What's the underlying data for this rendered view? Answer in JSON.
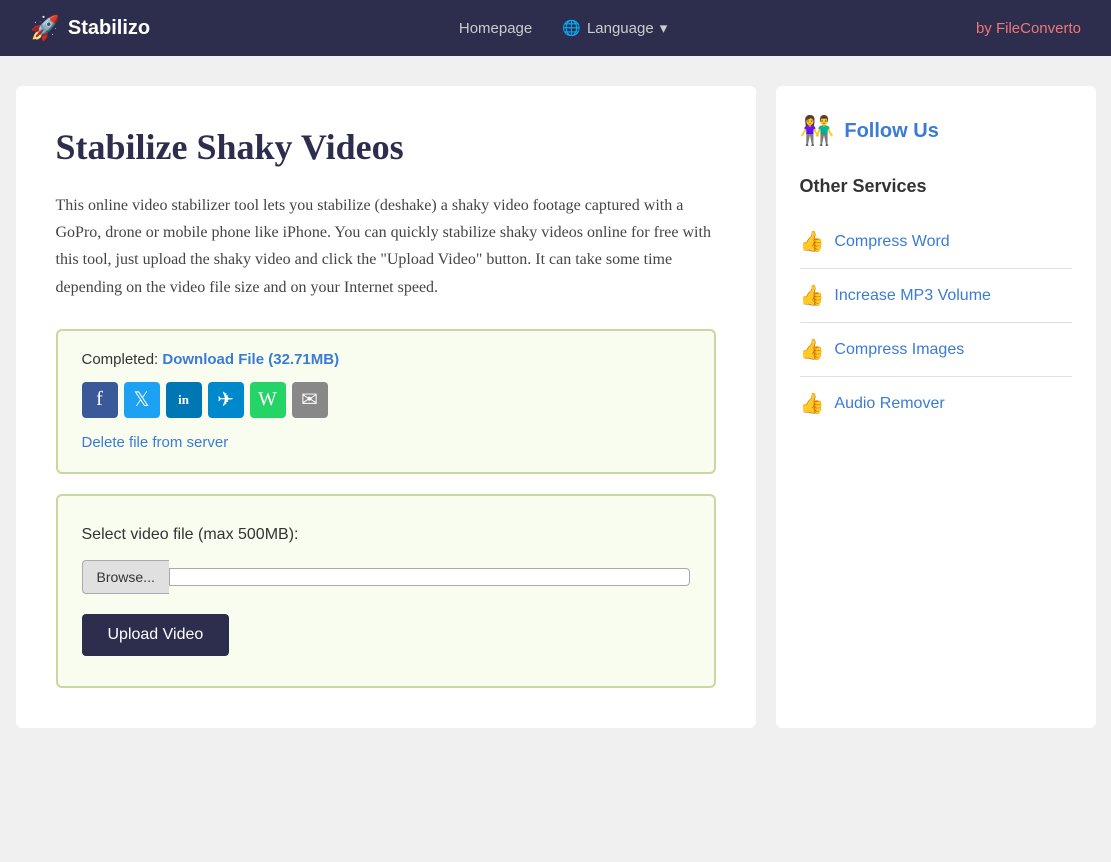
{
  "nav": {
    "logo_text": "Stabilizo",
    "logo_icon": "🚀",
    "homepage_label": "Homepage",
    "language_label": "Language",
    "language_icon": "🌐",
    "byline": "by FileConvert",
    "byline_highlight": "o"
  },
  "main": {
    "title": "Stabilize Shaky Videos",
    "description": "This online video stabilizer tool lets you stabilize (deshake) a shaky video footage captured with a GoPro, drone or mobile phone like iPhone. You can quickly stabilize shaky videos online for free with this tool, just upload the shaky video and click the \"Upload Video\" button. It can take some time depending on the video file size and on your Internet speed.",
    "completed_label": "Completed:",
    "download_link_text": "Download File (32.71MB)",
    "delete_link_text": "Delete file from server",
    "upload_section_label": "Select video file (max 500MB):",
    "browse_label": "Browse...",
    "upload_button_label": "Upload Video"
  },
  "social": {
    "facebook": "f",
    "twitter": "t",
    "linkedin": "in",
    "telegram": "✈",
    "whatsapp": "W",
    "email": "✉"
  },
  "sidebar": {
    "follow_us_icon": "👫",
    "follow_us_label": "Follow Us",
    "other_services_title": "Other Services",
    "services": [
      {
        "icon": "👍",
        "label": "Compress Word"
      },
      {
        "icon": "👍",
        "label": "Increase MP3 Volume"
      },
      {
        "icon": "👍",
        "label": "Compress Images"
      },
      {
        "icon": "👍",
        "label": "Audio Remover"
      }
    ]
  }
}
